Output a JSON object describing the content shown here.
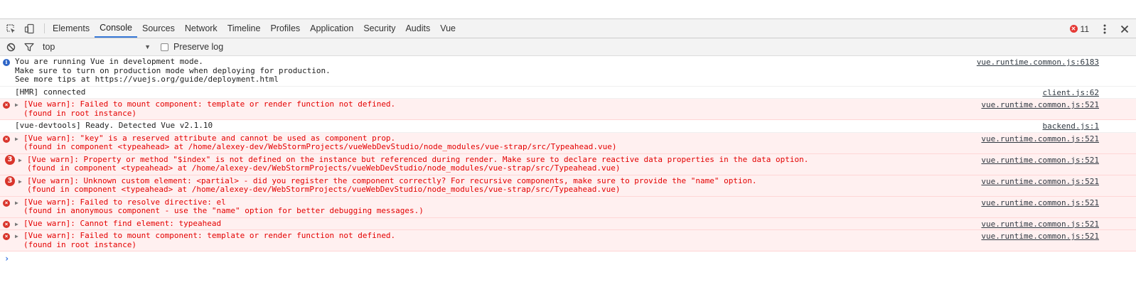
{
  "toolbar": {
    "tabs": [
      "Elements",
      "Console",
      "Sources",
      "Network",
      "Timeline",
      "Profiles",
      "Application",
      "Security",
      "Audits",
      "Vue"
    ],
    "active_tab": "Console",
    "error_count": "11"
  },
  "filterbar": {
    "context": "top",
    "preserve_log_label": "Preserve log"
  },
  "messages": [
    {
      "level": "info",
      "lines": [
        "You are running Vue in development mode.",
        "Make sure to turn on production mode when deploying for production.",
        "See more tips at https://vuejs.org/guide/deployment.html"
      ],
      "source": "vue.runtime.common.js:6183"
    },
    {
      "level": "log",
      "lines": [
        "[HMR] connected"
      ],
      "source": "client.js:62"
    },
    {
      "level": "error",
      "lines": [
        "[Vue warn]: Failed to mount component: template or render function not defined.",
        "(found in root instance)"
      ],
      "source": "vue.runtime.common.js:521"
    },
    {
      "level": "log",
      "lines": [
        "[vue-devtools] Ready. Detected Vue v2.1.10"
      ],
      "source": "backend.js:1"
    },
    {
      "level": "error",
      "lines": [
        "[Vue warn]: \"key\" is a reserved attribute and cannot be used as component prop.",
        "(found in component <typeahead> at /home/alexey-dev/WebStormProjects/vueWebDevStudio/node_modules/vue-strap/src/Typeahead.vue)"
      ],
      "source": "vue.runtime.common.js:521"
    },
    {
      "level": "error",
      "repeat": "3",
      "lines": [
        "[Vue warn]: Property or method \"$index\" is not defined on the instance but referenced during render. Make sure to declare reactive data properties in the data option.",
        "(found in component <typeahead> at /home/alexey-dev/WebStormProjects/vueWebDevStudio/node_modules/vue-strap/src/Typeahead.vue)"
      ],
      "source": "vue.runtime.common.js:521"
    },
    {
      "level": "error",
      "repeat": "3",
      "lines": [
        "[Vue warn]: Unknown custom element: <partial> - did you register the component correctly? For recursive components, make sure to provide the \"name\" option.",
        "(found in component <typeahead> at /home/alexey-dev/WebStormProjects/vueWebDevStudio/node_modules/vue-strap/src/Typeahead.vue)"
      ],
      "source": "vue.runtime.common.js:521"
    },
    {
      "level": "error",
      "lines": [
        "[Vue warn]: Failed to resolve directive: el",
        "(found in anonymous component - use the \"name\" option for better debugging messages.)"
      ],
      "source": "vue.runtime.common.js:521"
    },
    {
      "level": "error",
      "lines": [
        "[Vue warn]: Cannot find element: typeahead"
      ],
      "source": "vue.runtime.common.js:521"
    },
    {
      "level": "error",
      "lines": [
        "[Vue warn]: Failed to mount component: template or render function not defined.",
        "(found in root instance)"
      ],
      "source": "vue.runtime.common.js:521"
    }
  ]
}
